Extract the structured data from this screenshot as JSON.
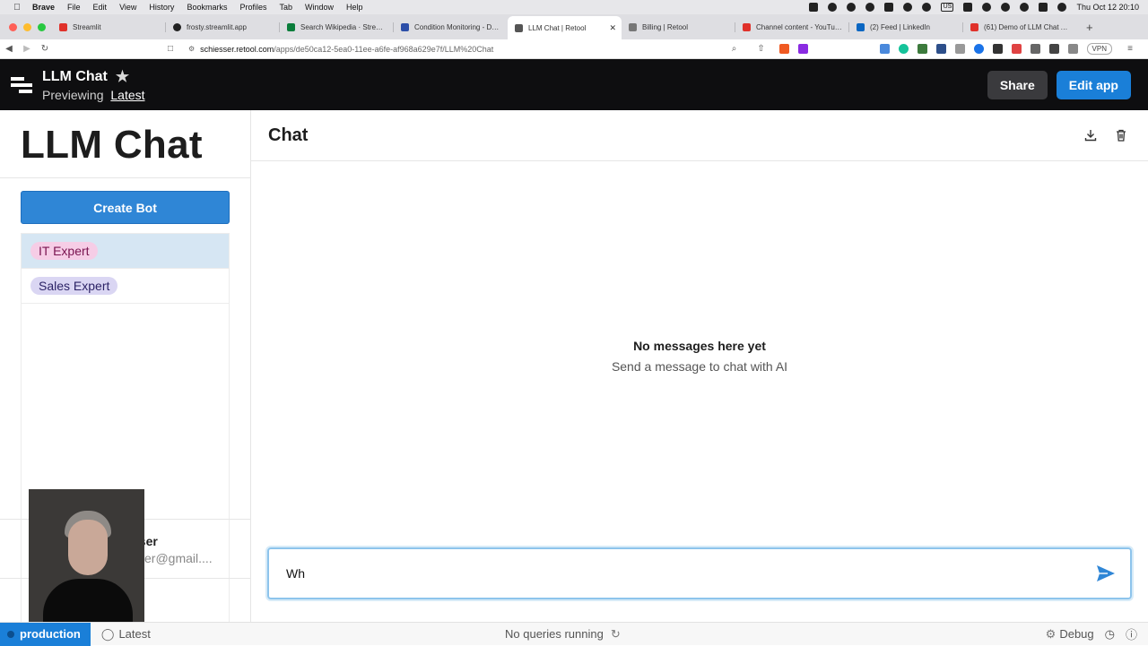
{
  "menubar": {
    "items": [
      "Brave",
      "File",
      "Edit",
      "View",
      "History",
      "Bookmarks",
      "Profiles",
      "Tab",
      "Window",
      "Help"
    ],
    "clock": "Thu Oct 12  20:10"
  },
  "browser": {
    "tabs": [
      {
        "label": "Streamlit",
        "color": "#e0312a"
      },
      {
        "label": "frosty.streamlit.app",
        "color": "#222222"
      },
      {
        "label": "Search Wikipedia · Streamlit",
        "color": "#0a7d3b"
      },
      {
        "label": "Condition Monitoring - De...",
        "color": "#2c4ea8"
      },
      {
        "label": "LLM Chat | Retool",
        "color": "#555555",
        "active": true
      },
      {
        "label": "Billing | Retool",
        "color": "#777777"
      },
      {
        "label": "Channel content - YouTube",
        "color": "#e0312a"
      },
      {
        "label": "(2) Feed | LinkedIn",
        "color": "#0a66c2"
      },
      {
        "label": "(61) Demo of LLM Chat App",
        "color": "#e0312a"
      }
    ],
    "url_host": "schiesser.retool.com",
    "url_path": "/apps/de50ca12-5ea0-11ee-a6fe-af968a629e7f/LLM%20Chat",
    "vpn_label": "VPN"
  },
  "header": {
    "title": "LLM Chat",
    "previewing_label": "Previewing",
    "version_label": "Latest",
    "share_label": "Share",
    "edit_label": "Edit app"
  },
  "sidebar": {
    "title": "LLM Chat",
    "create_button": "Create Bot",
    "bots": [
      {
        "label": "IT Expert",
        "pill_bg": "#f6cde6",
        "pill_color": "#7a1450",
        "selected": true
      },
      {
        "label": "Sales Expert",
        "pill_bg": "#dad6f3",
        "pill_color": "#2c2366",
        "selected": false
      }
    ],
    "user": {
      "name": "sser",
      "email": "sser@gmail...."
    }
  },
  "chat": {
    "title": "Chat",
    "empty_title": "No messages here yet",
    "empty_subtitle": "Send a message to chat with AI",
    "input_value": "Wh"
  },
  "statusbar": {
    "environment": "production",
    "version": "Latest",
    "queries": "No queries running",
    "debug_label": "Debug"
  },
  "colors": {
    "accent": "#1a7fd8",
    "header_bg": "#0e0e10"
  }
}
